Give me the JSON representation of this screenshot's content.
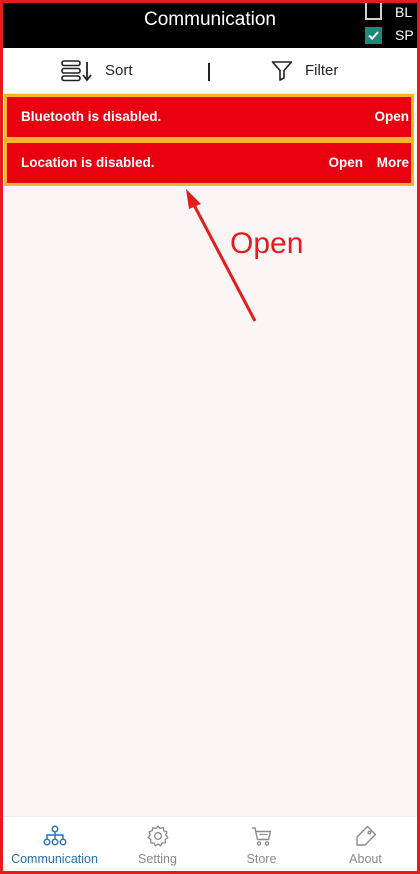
{
  "header": {
    "title": "Communication",
    "checkboxes": [
      {
        "label": "BL",
        "checked": false
      },
      {
        "label": "SP",
        "checked": true
      }
    ]
  },
  "toolbar": {
    "sort_label": "Sort",
    "filter_label": "Filter"
  },
  "banners": [
    {
      "message": "Bluetooth is disabled.",
      "actions": [
        "Open"
      ]
    },
    {
      "message": "Location is disabled.",
      "actions": [
        "Open",
        "More"
      ]
    }
  ],
  "annotation": {
    "text": "Open",
    "color": "#e31c1c"
  },
  "bottom_nav": {
    "items": [
      {
        "label": "Communication",
        "icon": "hierarchy-icon",
        "active": true
      },
      {
        "label": "Setting",
        "icon": "gear-icon",
        "active": false
      },
      {
        "label": "Store",
        "icon": "cart-icon",
        "active": false
      },
      {
        "label": "About",
        "icon": "tag-icon",
        "active": false
      }
    ]
  },
  "colors": {
    "banner": "#e8000e",
    "highlight": "#f5b42a",
    "active_nav": "#2a6fb0",
    "checkbox_checked": "#1a8a7a"
  }
}
